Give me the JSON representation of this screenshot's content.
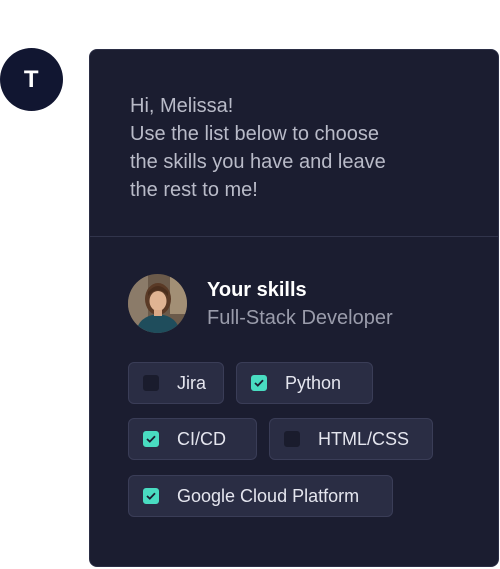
{
  "bot_avatar": {
    "initial": "T",
    "color": "#111631"
  },
  "message": {
    "lines": [
      "Hi, Melissa!",
      "Use the list below to choose",
      "the skills you have and leave",
      "the rest to me!"
    ]
  },
  "profile": {
    "title": "Your skills",
    "subtitle": "Full-Stack Developer"
  },
  "skills": [
    {
      "label": "Jira",
      "checked": false
    },
    {
      "label": "Python",
      "checked": true
    },
    {
      "label": "CI/CD",
      "checked": true
    },
    {
      "label": "HTML/CSS",
      "checked": false
    },
    {
      "label": "Google Cloud Platform",
      "checked": true
    }
  ],
  "colors": {
    "card_bg": "#1b1d30",
    "chip_bg": "#2a2d44",
    "accent_check": "#49dcc1"
  }
}
